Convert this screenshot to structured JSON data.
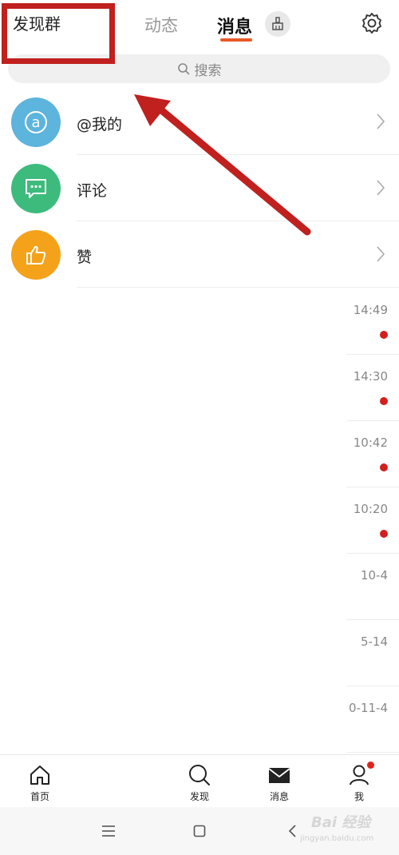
{
  "header": {
    "discover_group": "发现群",
    "tabs": [
      {
        "label": "动态"
      },
      {
        "label": "消息"
      }
    ]
  },
  "search": {
    "placeholder": "搜索"
  },
  "top_rows": [
    {
      "label": "@我的",
      "icon": "at-icon",
      "color": "#5db4dc"
    },
    {
      "label": "评论",
      "icon": "comment-icon",
      "color": "#3dbb7d"
    },
    {
      "label": "赞",
      "icon": "thumbs-up-icon",
      "color": "#f5a21b"
    }
  ],
  "conversations": [
    {
      "time": "14:49",
      "unread": true
    },
    {
      "time": "14:30",
      "unread": true
    },
    {
      "time": "10:42",
      "unread": true
    },
    {
      "time": "10:20",
      "unread": true
    },
    {
      "time": "10-4",
      "unread": false
    },
    {
      "time": "5-14",
      "unread": false
    },
    {
      "time": "0-11-4",
      "unread": false
    }
  ],
  "bottom_nav": {
    "home": "首页",
    "discover": "发现",
    "messages": "消息",
    "me": "我"
  },
  "watermark": {
    "text": "Bai 经验",
    "sub": "jingyan.baidu.com"
  },
  "colors": {
    "accent": "#e95a2a",
    "annotation": "#c0201e",
    "unread_dot": "#d21f1f"
  }
}
